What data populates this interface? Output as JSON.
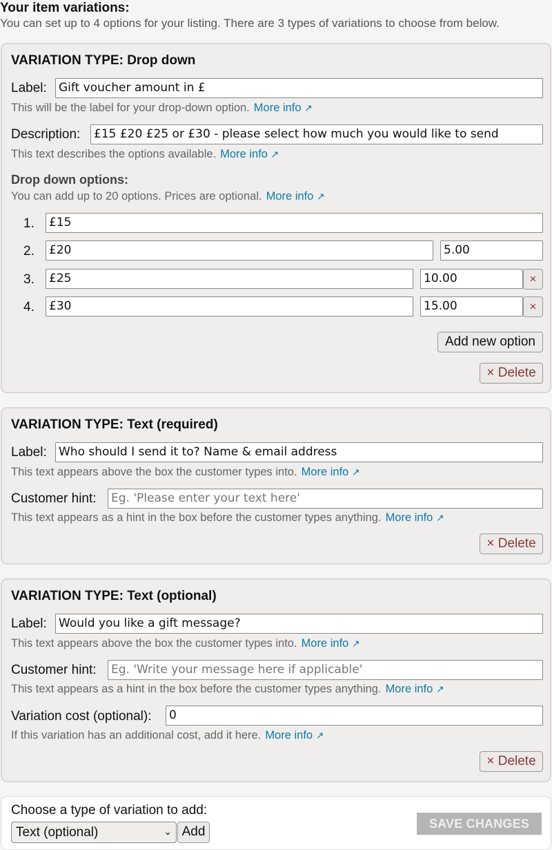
{
  "header": {
    "title": "Your item variations:",
    "subtitle": "You can set up to 4 options for your listing. There are 3 types of variations to choose from below."
  },
  "common": {
    "more_info": "More info",
    "ext_icon": "↗",
    "delete_label": "× Delete",
    "remove_glyph": "×"
  },
  "dropdown_panel": {
    "title": "VARIATION TYPE: Drop down",
    "label_caption": "Label:",
    "label_value": "Gift voucher amount in £",
    "label_help": "This will be the label for your drop-down option.",
    "desc_caption": "Description:",
    "desc_value": "£15 £20 £25 or £30 - please select how much you would like to send",
    "desc_help": "This text describes the options available.",
    "options_heading": "Drop down options:",
    "options_help": "You can add up to 20 options. Prices are optional.",
    "options": [
      {
        "num": "1.",
        "name": "£15",
        "price": ""
      },
      {
        "num": "2.",
        "name": "£20",
        "price": "5.00"
      },
      {
        "num": "3.",
        "name": "£25",
        "price": "10.00"
      },
      {
        "num": "4.",
        "name": "£30",
        "price": "15.00"
      }
    ],
    "add_option_label": "Add new option"
  },
  "text_required_panel": {
    "title": "VARIATION TYPE: Text (required)",
    "label_caption": "Label:",
    "label_value": "Who should I send it to? Name & email address",
    "label_help": "This text appears above the box the customer types into.",
    "hint_caption": "Customer hint:",
    "hint_placeholder": "Eg. 'Please enter your text here'",
    "hint_help": "This text appears as a hint in the box before the customer types anything."
  },
  "text_optional_panel": {
    "title": "VARIATION TYPE: Text (optional)",
    "label_caption": "Label:",
    "label_value": "Would you like a gift message?",
    "label_help": "This text appears above the box the customer types into.",
    "hint_caption": "Customer hint:",
    "hint_placeholder": "Eg. 'Write your message here if applicable'",
    "hint_help": "This text appears as a hint in the box before the customer types anything.",
    "cost_caption": "Variation cost (optional):",
    "cost_value": "0",
    "cost_help": "If this variation has an additional cost, add it here."
  },
  "add_variation": {
    "caption": "Choose a type of variation to add:",
    "selected": "Text (optional)",
    "add_label": "Add",
    "save_label": "SAVE CHANGES"
  },
  "colors": {
    "link": "#0e7ba6",
    "delete": "#8b3a3a",
    "panel_bg": "#efeeec",
    "save_disabled": "#b5b5b5"
  }
}
